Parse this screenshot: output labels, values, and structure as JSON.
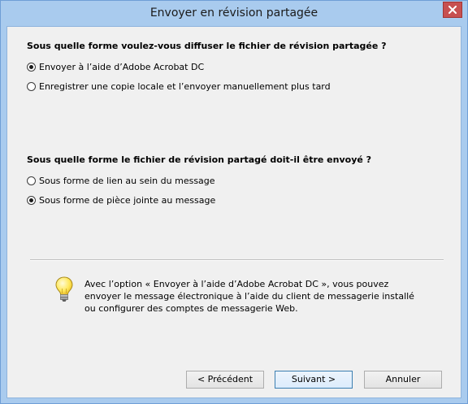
{
  "window": {
    "title": "Envoyer en révision partagée"
  },
  "distribution": {
    "question": "Sous quelle forme voulez-vous diffuser le fichier de révision partagée ?",
    "options": [
      {
        "label": "Envoyer à l’aide d’Adobe Acrobat DC",
        "selected": true
      },
      {
        "label": "Enregistrer une copie locale et l’envoyer manuellement plus tard",
        "selected": false
      }
    ]
  },
  "delivery": {
    "question": "Sous quelle forme le fichier de révision partagé doit-il être envoyé ?",
    "options": [
      {
        "label": "Sous forme de lien au sein du message",
        "selected": false
      },
      {
        "label": "Sous forme de pièce jointe au message",
        "selected": true
      }
    ]
  },
  "info": {
    "text": "Avec l’option « Envoyer à l’aide d’Adobe Acrobat DC », vous pouvez envoyer le message électronique à l’aide du client de messagerie installé ou configurer des comptes de messagerie Web.",
    "icon": "lightbulb-icon"
  },
  "buttons": {
    "previous": "< Précédent",
    "next": "Suivant >",
    "cancel": "Annuler"
  },
  "colors": {
    "frame": "#a9cbee",
    "close": "#c75050",
    "client": "#f0f0f0",
    "default_button_border": "#3c7fb1"
  }
}
